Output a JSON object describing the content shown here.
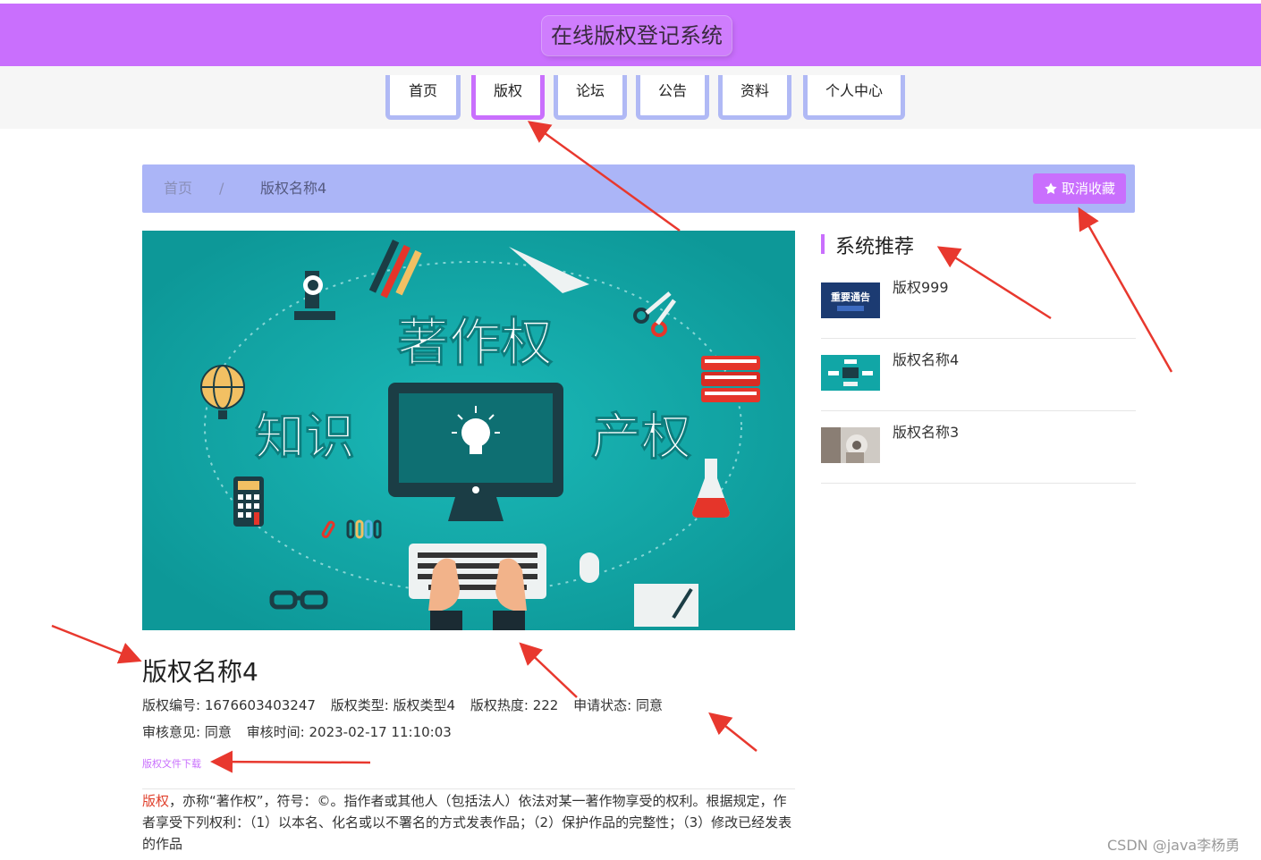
{
  "header": {
    "site_title": "在线版权登记系统"
  },
  "nav": {
    "items": [
      {
        "label": "首页"
      },
      {
        "label": "版权",
        "active": true
      },
      {
        "label": "论坛"
      },
      {
        "label": "公告"
      },
      {
        "label": "资料"
      },
      {
        "label": "个人中心"
      }
    ]
  },
  "breadcrumb": {
    "home": "首页",
    "separator": "/",
    "current": "版权名称4"
  },
  "actions": {
    "favorite_button": "取消收藏",
    "favorite_icon": "star-icon"
  },
  "hero_image": {
    "center_text": "著作权",
    "left_text": "知识",
    "right_text": "产权"
  },
  "detail": {
    "title": "版权名称4",
    "meta": {
      "number_label": "版权编号:",
      "number_value": "1676603403247",
      "type_label": "版权类型:",
      "type_value": "版权类型4",
      "heat_label": "版权热度:",
      "heat_value": "222",
      "status_label": "申请状态:",
      "status_value": "同意",
      "review_label": "审核意见:",
      "review_value": "同意",
      "review_time_label": "审核时间:",
      "review_time_value": "2023-02-17 11:10:03"
    },
    "download_link": "版权文件下载",
    "description_highlight": "版权",
    "description_rest": "，亦称“著作权”，符号：©。指作者或其他人（包括法人）依法对某一著作物享受的权利。根据规定，作者享受下列权利：（1）以本名、化名或以不署名的方式发表作品；（2）保护作品的完整性；（3）修改已经发表的作品"
  },
  "recommend": {
    "title": "系统推荐",
    "items": [
      {
        "label": "版权999",
        "thumb_text": "重要通告"
      },
      {
        "label": "版权名称4",
        "thumb_text": ""
      },
      {
        "label": "版权名称3",
        "thumb_text": ""
      }
    ]
  },
  "watermark": "CSDN @java李杨勇",
  "colors": {
    "topbar": "#c96ffd",
    "nav_border": "#b0b9f5",
    "breadcrumb_bg": "#abb5f7",
    "hero_bg": "#11a6a6",
    "annotation_arrow": "#e8382e"
  }
}
